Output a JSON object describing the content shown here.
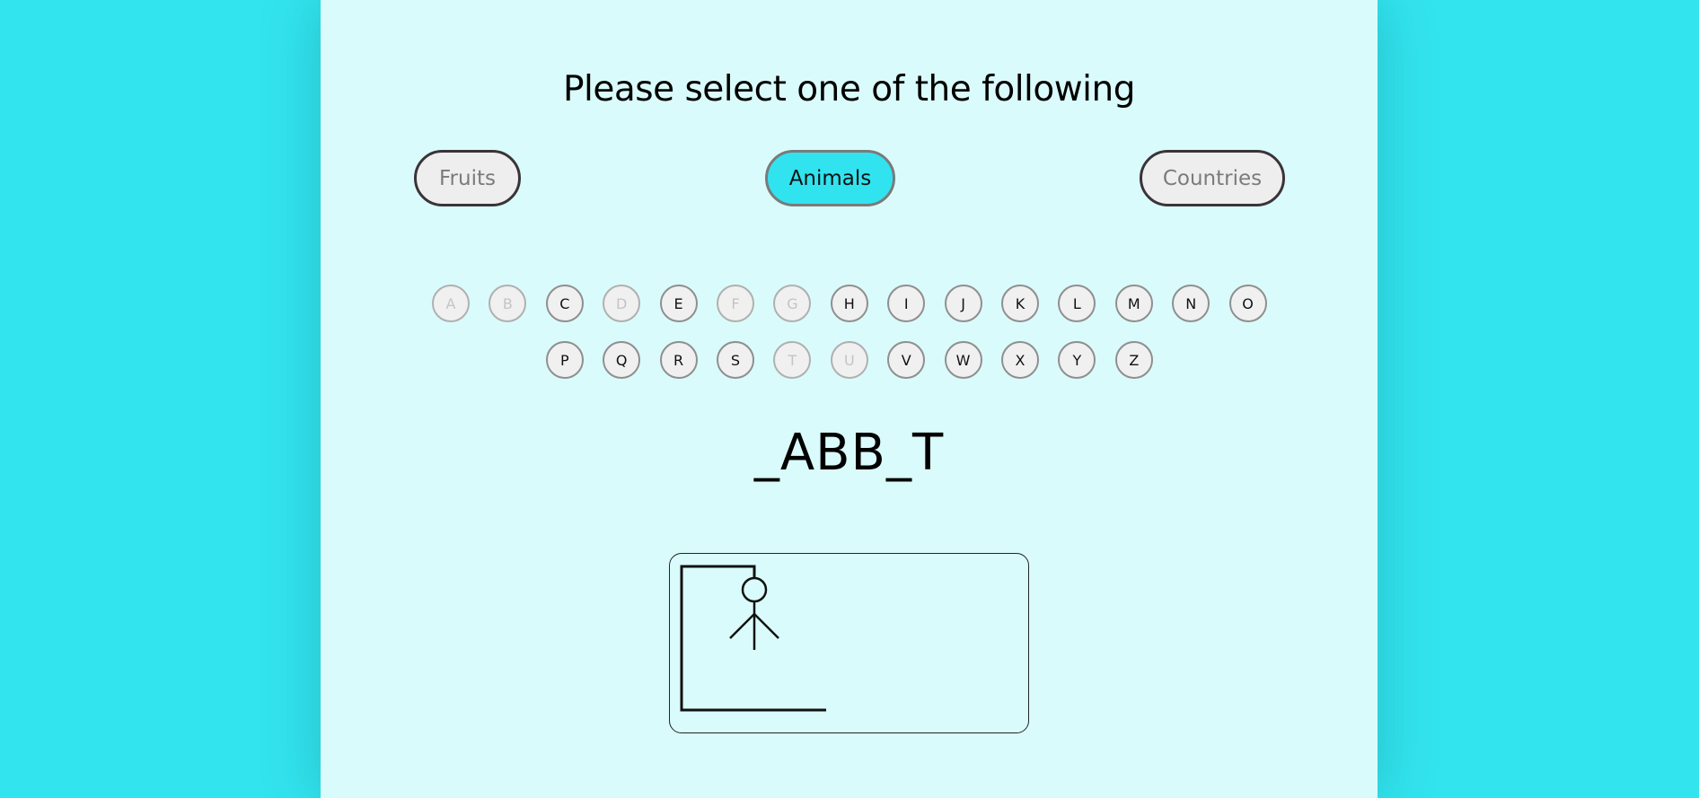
{
  "title": "Please select one of the following",
  "categories": [
    {
      "label": "Fruits",
      "active": false
    },
    {
      "label": "Animals",
      "active": true
    },
    {
      "label": "Countries",
      "active": false
    }
  ],
  "letters_row1": [
    "A",
    "B",
    "C",
    "D",
    "E",
    "F",
    "G",
    "H",
    "I",
    "J",
    "K",
    "L",
    "M",
    "N",
    "O"
  ],
  "letters_row2": [
    "P",
    "Q",
    "R",
    "S",
    "T",
    "U",
    "V",
    "W",
    "X",
    "Y",
    "Z"
  ],
  "used_letters": [
    "A",
    "B",
    "D",
    "F",
    "G",
    "T",
    "U"
  ],
  "word_display": "_ABB_T",
  "colors": {
    "background": "#32e4ee",
    "panel": "#dafbfb",
    "active_button": "#31e3ef"
  }
}
